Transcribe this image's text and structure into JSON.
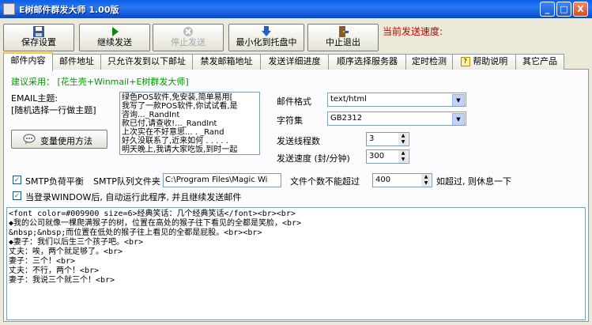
{
  "window": {
    "title": "E树邮件群发大师 1.00版",
    "minimize": "_",
    "maximize": "□",
    "close": "X"
  },
  "toolbar": {
    "save": "保存设置",
    "continue": "继续发送",
    "stop": "停止发送",
    "tray": "最小化到托盘中",
    "exit": "中止退出",
    "speed_label": "当前发送速度:"
  },
  "tabs": [
    "邮件内容",
    "邮件地址",
    "只允许发到以下邮址",
    "禁发邮箱地址",
    "发送详细进度",
    "顺序选择服务器",
    "定时检测",
    "帮助说明",
    "其它产品"
  ],
  "recommend": "建议采用： [花生壳+Winmail+E树群发大师]",
  "subject": {
    "label": "EMAIL主题:",
    "hint": "[随机选择一行做主题]",
    "lines": [
      "绿色POS软件,免安装,简单易用[",
      "我写了一款POS软件,你试试看,是",
      "咨询..._RandInt",
      "款已付,请查收!..._RandInt",
      "上次实在不好意思... . _Rand",
      "好久没联系了,近来如何 . . . . .",
      "明天晚上,我请大家吃饭,到时一起"
    ]
  },
  "var_button": "变量使用方法",
  "settings": {
    "format_label": "邮件格式",
    "format_value": "text/html",
    "charset_label": "字符集",
    "charset_value": "GB2312",
    "threads_label": "发送线程数",
    "threads_value": "3",
    "rate_label": "发送速度 (封/分钟)",
    "rate_value": "300"
  },
  "smtp": {
    "balance_label": "SMTP负荷平衡",
    "balance_checked": true,
    "queue_label": "SMTP队列文件夹",
    "queue_value": "C:\\Program Files\\Magic Wi",
    "count_label": "文件个数不能超过",
    "count_value": "400",
    "rest_label": "如超过, 则休息一下"
  },
  "autostart": {
    "label": "当登录WINDOW后, 自动运行此程序, 并且继续发送邮件",
    "checked": true
  },
  "content_lines": [
    "<font color=#009900 size=6>经典笑话：几个经典笑话</font><br><br>",
    "◆我的公司就像一棵爬满猴子的树，位置在高处的猴子往下看见的全都是笑脸，<br>",
    "&nbsp;&nbsp;而位置在低处的猴子往上看见的全都是屁股。<br><br>",
    "",
    "◆妻子：我们以后生三个孩子吧。<br>",
    "丈夫：唉，两个就足够了。<br>",
    "妻子：三个！<br>",
    "丈夫：不行，两个！<br>",
    "妻子：我说三个就三个！<br>"
  ],
  "colors": {
    "title_bar": "#0a5fe8",
    "accent_red": "#c00000",
    "green_text": "#009900",
    "tab_highlight": "#ffc83c"
  }
}
